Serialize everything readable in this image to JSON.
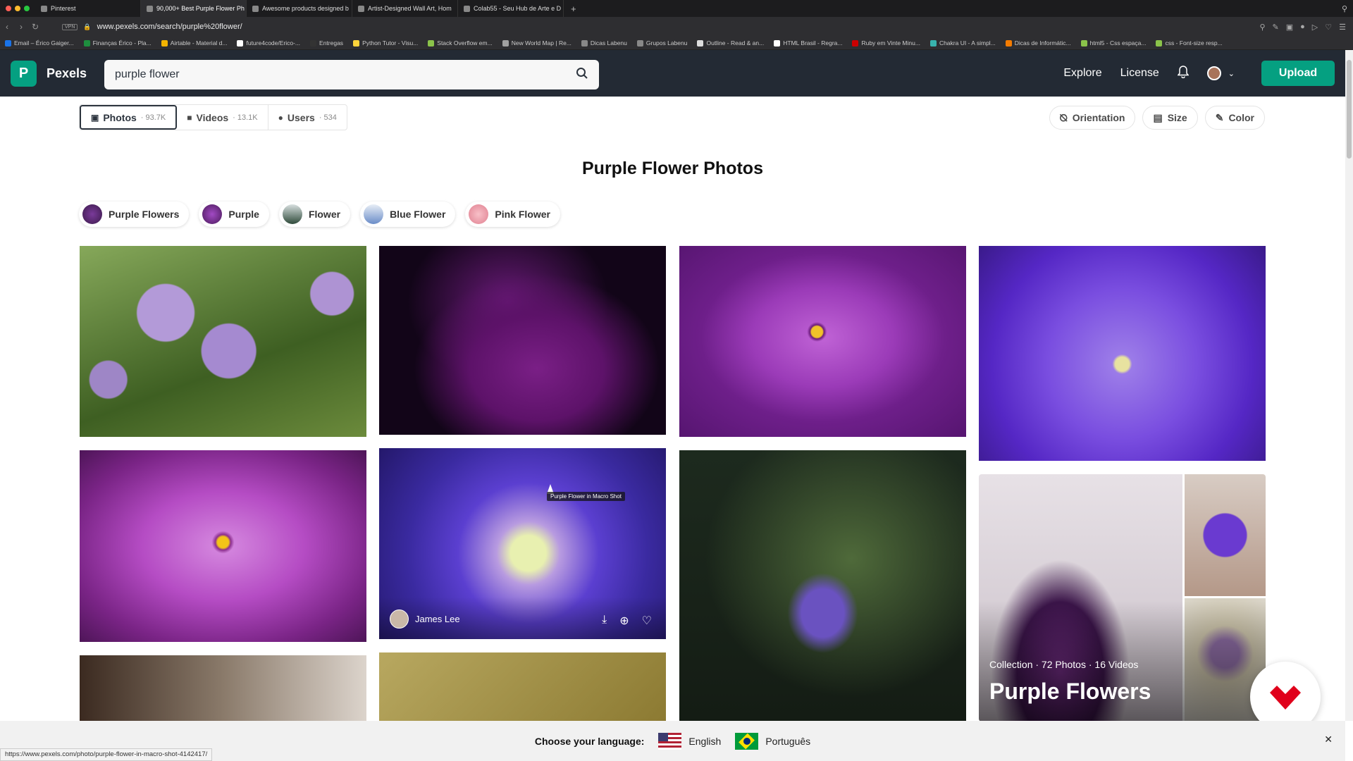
{
  "browser": {
    "tabs": [
      {
        "label": "Pinterest",
        "active": false
      },
      {
        "label": "90,000+ Best Purple Flower Ph",
        "active": true
      },
      {
        "label": "Awesome products designed b",
        "active": false
      },
      {
        "label": "Artist-Designed Wall Art, Hom",
        "active": false
      },
      {
        "label": "Colab55 - Seu Hub de Arte e D",
        "active": false
      }
    ],
    "new_tab": "+",
    "vpn_label": "VPN",
    "url": "www.pexels.com/search/purple%20flower/",
    "bookmarks": [
      {
        "label": "Email – Érico Gaiger...",
        "color": "#1a73e8"
      },
      {
        "label": "Finanças Érico - Pla...",
        "color": "#1e8e3e"
      },
      {
        "label": "Airtable - Material d...",
        "color": "#f4b400"
      },
      {
        "label": "future4code/Erico-...",
        "color": "#ffffff"
      },
      {
        "label": "Entregas",
        "color": "#333333"
      },
      {
        "label": "Python Tutor - Visu...",
        "color": "#ffd43b"
      },
      {
        "label": "Stack Overflow em...",
        "color": "#8bc34a"
      },
      {
        "label": "New World Map | Re...",
        "color": "#a0a0a0"
      },
      {
        "label": "Dicas Labenu",
        "color": "#888888"
      },
      {
        "label": "Grupos Labenu",
        "color": "#888888"
      },
      {
        "label": "Outline - Read & an...",
        "color": "#dddddd"
      },
      {
        "label": "HTML Brasil - Regra...",
        "color": "#ffffff"
      },
      {
        "label": "Ruby em Vinte Minu...",
        "color": "#cc0000"
      },
      {
        "label": "Chakra UI - A simpl...",
        "color": "#38b2ac"
      },
      {
        "label": "Dicas de Informátic...",
        "color": "#f57c00"
      },
      {
        "label": "html5 - Css espaça...",
        "color": "#8bc34a"
      },
      {
        "label": "css - Font-size resp...",
        "color": "#8bc34a"
      }
    ],
    "status_url": "https://www.pexels.com/photo/purple-flower-in-macro-shot-4142417/"
  },
  "header": {
    "brand": "Pexels",
    "logo_letter": "P",
    "search_value": "purple flower",
    "nav": {
      "explore": "Explore",
      "license": "License"
    },
    "upload_label": "Upload"
  },
  "media_tabs": [
    {
      "label": "Photos",
      "count": "· 93.7K",
      "active": true,
      "icon": "image-icon"
    },
    {
      "label": "Videos",
      "count": "· 13.1K",
      "active": false,
      "icon": "video-icon"
    },
    {
      "label": "Users",
      "count": "· 534",
      "active": false,
      "icon": "user-icon"
    }
  ],
  "filters": {
    "orientation": "Orientation",
    "size": "Size",
    "color": "Color"
  },
  "page_title": "Purple Flower Photos",
  "related_chips": [
    {
      "label": "Purple Flowers",
      "color": "#3b1a4a"
    },
    {
      "label": "Purple",
      "color": "#6a2a8a"
    },
    {
      "label": "Flower",
      "color": "#2f4a3a"
    },
    {
      "label": "Blue Flower",
      "color": "#9bb4d8"
    },
    {
      "label": "Pink Flower",
      "color": "#f0a0a8"
    }
  ],
  "hovered_photo": {
    "tooltip": "Purple Flower in Macro Shot",
    "author": "James Lee"
  },
  "collection": {
    "meta": "Collection · 72 Photos · 16 Videos",
    "title": "Purple Flowers"
  },
  "language_bar": {
    "prompt": "Choose your language:",
    "options": [
      "English",
      "Português"
    ]
  },
  "colors": {
    "brand_green": "#05a081",
    "header_bg": "#232a34"
  }
}
